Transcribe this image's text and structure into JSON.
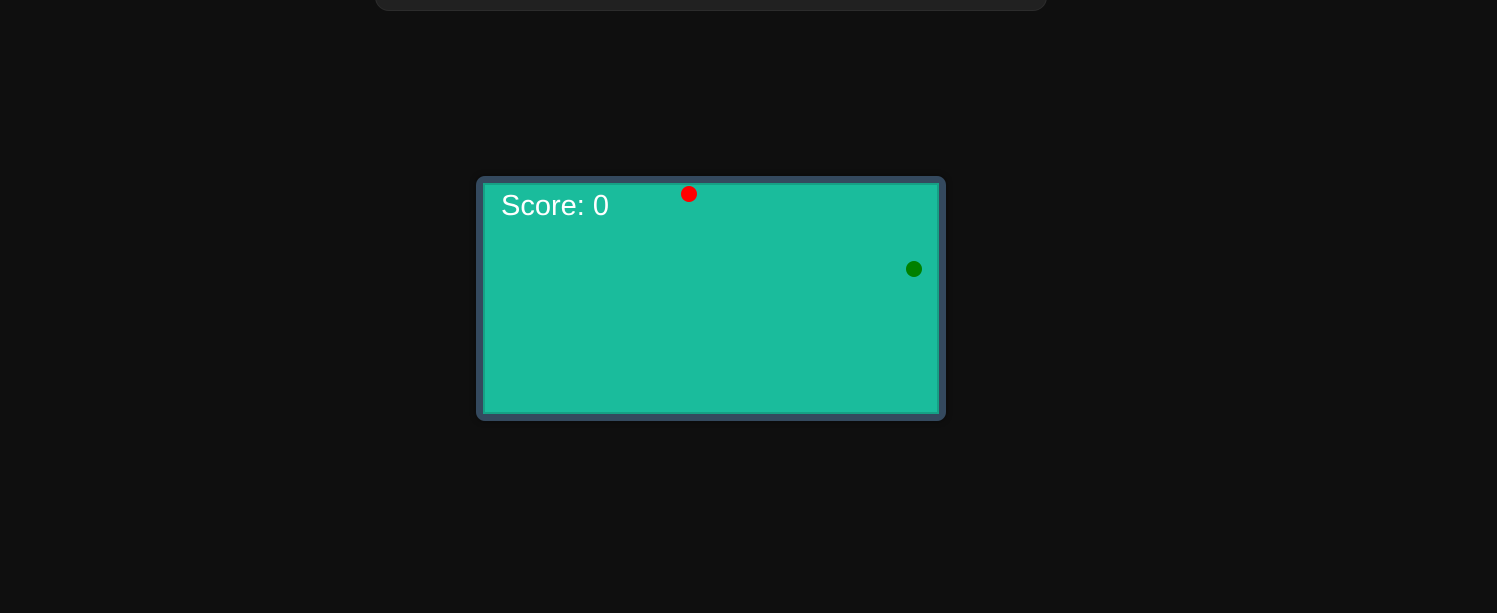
{
  "game": {
    "score_label": "Score: 0",
    "colors": {
      "background": "#0f0f0f",
      "frame": "#34495e",
      "field": "#1abc9c",
      "field_border": "#16a085",
      "food": "#ff0000",
      "player": "#008000"
    }
  }
}
